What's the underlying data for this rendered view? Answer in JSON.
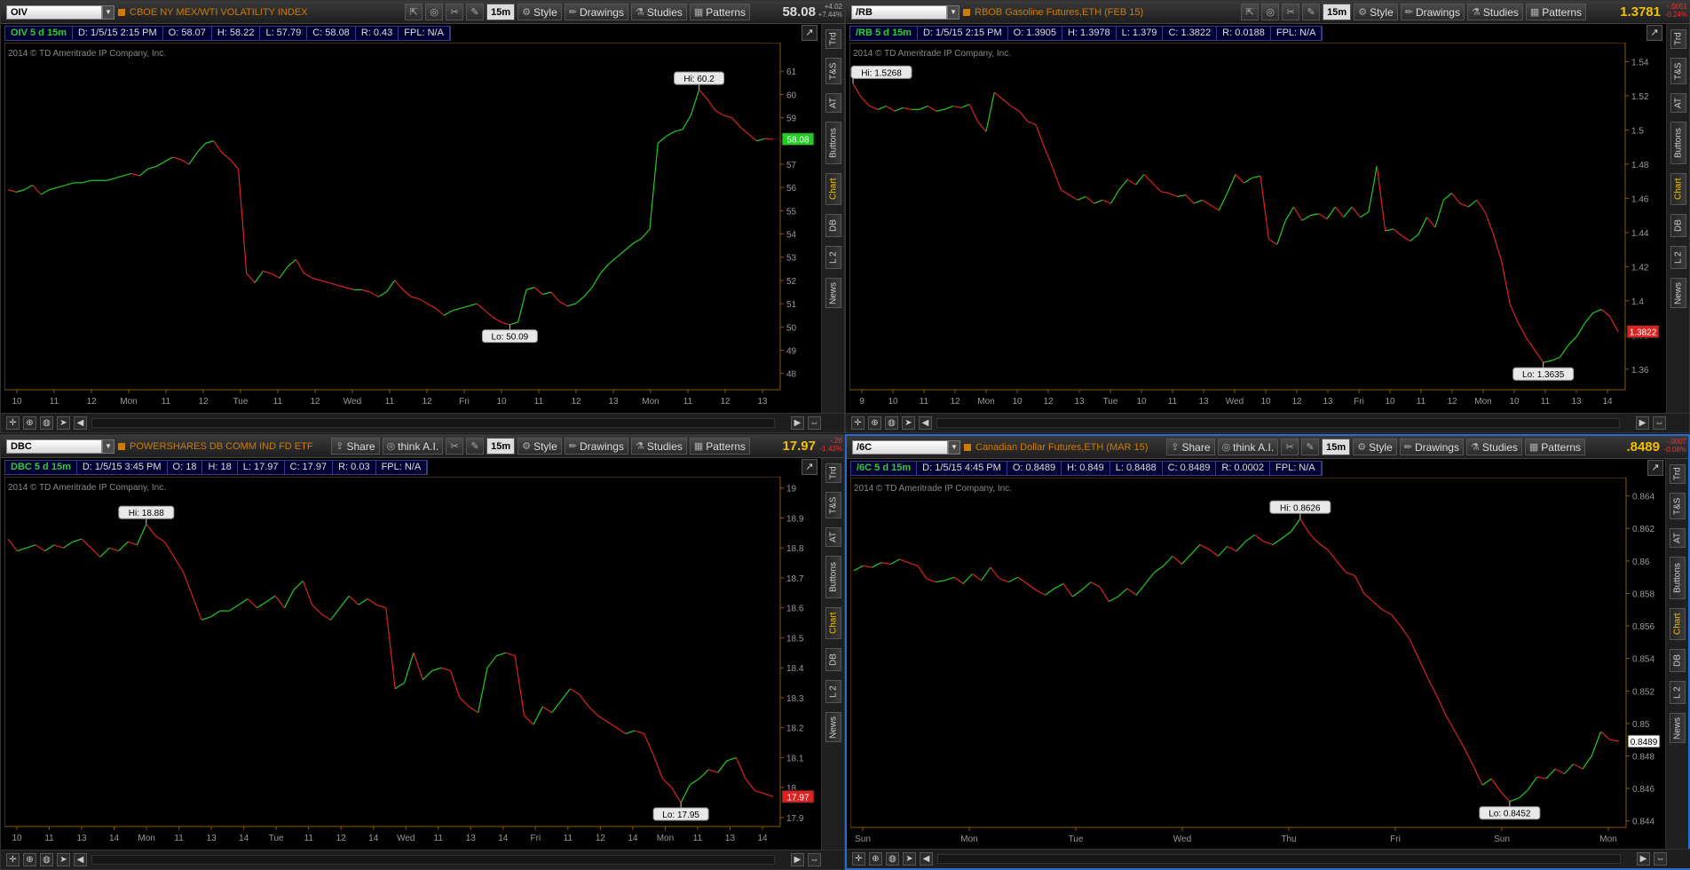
{
  "toolbar_labels": {
    "share": "Share",
    "think": "think A.I.",
    "timeframe": "15m",
    "style": "Style",
    "drawings": "Drawings",
    "studies": "Studies",
    "patterns": "Patterns"
  },
  "side_tabs": [
    "Trd",
    "T&S",
    "AT",
    "Buttons",
    "Chart",
    "DB",
    "L 2",
    "News"
  ],
  "copyright": "2014 © TD Ameritrade IP Company, Inc.",
  "colors": {
    "up": "#22cc22",
    "down": "#dd2222",
    "axis": "#8a5a00",
    "active_border": "#2a6bd0"
  },
  "panes": [
    {
      "symbol": "OIV",
      "description": "CBOE NY MEX/WTI VOLATILITY INDEX",
      "last": "58.08",
      "change_top": "+4.02",
      "change_bottom": "+7.44%",
      "change_dir": "up",
      "show_share": false,
      "active": false,
      "info": {
        "label": "OIV 5 d 15m",
        "date": "D: 1/5/15 2:15 PM",
        "open": "O: 58.07",
        "high": "H: 58.22",
        "low": "L: 57.79",
        "close": "C: 58.08",
        "range": "R: 0.43",
        "fpl": "FPL: N/A"
      },
      "chart_data": {
        "type": "line",
        "ylim": [
          47.3,
          62.0
        ],
        "y_ticks": [
          "48",
          "49",
          "50",
          "51",
          "52",
          "53",
          "54",
          "55",
          "56",
          "57",
          "58",
          "59",
          "60",
          "61"
        ],
        "x_ticks": [
          "10",
          "11",
          "12",
          "Mon",
          "11",
          "12",
          "Tue",
          "11",
          "12",
          "Wed",
          "11",
          "12",
          "Fri",
          "10",
          "11",
          "12",
          "13",
          "Mon",
          "11",
          "12",
          "13"
        ],
        "hi": {
          "label": "Hi: 60.2",
          "value": 60.2
        },
        "lo": {
          "label": "Lo: 50.09",
          "value": 50.09
        },
        "last_price_label": "58.08",
        "last_price_color": "#22cc22",
        "values": [
          55.9,
          55.8,
          55.9,
          56.1,
          55.7,
          55.9,
          56.0,
          56.1,
          56.2,
          56.2,
          56.3,
          56.3,
          56.3,
          56.4,
          56.5,
          56.6,
          56.5,
          56.8,
          56.9,
          57.1,
          57.3,
          57.2,
          57.0,
          57.5,
          57.9,
          58.0,
          57.5,
          57.2,
          56.8,
          52.3,
          51.9,
          52.4,
          52.3,
          52.1,
          52.6,
          52.9,
          52.3,
          52.1,
          52.0,
          51.9,
          51.8,
          51.7,
          51.6,
          51.6,
          51.5,
          51.3,
          51.5,
          52.0,
          51.6,
          51.3,
          51.2,
          51.0,
          50.8,
          50.5,
          50.7,
          50.8,
          50.9,
          51.0,
          50.7,
          50.4,
          50.2,
          50.1,
          50.2,
          51.6,
          51.7,
          51.4,
          51.5,
          51.1,
          50.9,
          51.0,
          51.3,
          51.7,
          52.3,
          52.7,
          53.0,
          53.3,
          53.6,
          53.8,
          54.2,
          57.9,
          58.2,
          58.4,
          58.5,
          59.1,
          60.2,
          59.8,
          59.3,
          59.1,
          59.0,
          58.6,
          58.3,
          58.0,
          58.1,
          58.08
        ]
      }
    },
    {
      "symbol": "/RB",
      "description": "RBOB Gasoline Futures,ETH (FEB 15)",
      "last": "1.3781",
      "change_top": "-.0051",
      "change_bottom": "-0.24%",
      "change_dir": "dn",
      "show_share": false,
      "active": false,
      "info": {
        "label": "/RB 5 d 15m",
        "date": "D: 1/5/15 2:15 PM",
        "open": "O: 1.3905",
        "high": "H: 1.3978",
        "low": "L: 1.379",
        "close": "C: 1.3822",
        "range": "R: 0.0188",
        "fpl": "FPL: N/A"
      },
      "chart_data": {
        "type": "line",
        "ylim": [
          1.348,
          1.548
        ],
        "y_ticks": [
          "1.36",
          "1.38",
          "1.4",
          "1.42",
          "1.44",
          "1.46",
          "1.48",
          "1.5",
          "1.52",
          "1.54"
        ],
        "x_ticks": [
          "9",
          "10",
          "11",
          "12",
          "Mon",
          "10",
          "12",
          "13",
          "Tue",
          "10",
          "11",
          "13",
          "Wed",
          "10",
          "12",
          "13",
          "Fri",
          "10",
          "11",
          "12",
          "Mon",
          "10",
          "11",
          "13",
          "14"
        ],
        "hi": {
          "label": "Hi: 1.5268",
          "value": 1.5268
        },
        "lo": {
          "label": "Lo: 1.3635",
          "value": 1.3635
        },
        "last_price_label": "1.3822",
        "last_price_color": "#dd2222",
        "values": [
          1.527,
          1.519,
          1.514,
          1.512,
          1.514,
          1.511,
          1.513,
          1.512,
          1.512,
          1.514,
          1.511,
          1.512,
          1.514,
          1.513,
          1.515,
          1.505,
          1.499,
          1.522,
          1.518,
          1.514,
          1.511,
          1.505,
          1.503,
          1.49,
          1.478,
          1.465,
          1.462,
          1.459,
          1.461,
          1.457,
          1.459,
          1.457,
          1.465,
          1.471,
          1.468,
          1.474,
          1.469,
          1.464,
          1.463,
          1.461,
          1.462,
          1.457,
          1.459,
          1.456,
          1.453,
          1.463,
          1.474,
          1.469,
          1.472,
          1.473,
          1.436,
          1.433,
          1.447,
          1.455,
          1.447,
          1.45,
          1.451,
          1.448,
          1.455,
          1.449,
          1.455,
          1.449,
          1.452,
          1.479,
          1.441,
          1.442,
          1.438,
          1.435,
          1.439,
          1.449,
          1.443,
          1.459,
          1.463,
          1.457,
          1.455,
          1.459,
          1.452,
          1.439,
          1.423,
          1.398,
          1.387,
          1.378,
          1.371,
          1.364,
          1.365,
          1.367,
          1.374,
          1.379,
          1.387,
          1.393,
          1.395,
          1.391,
          1.382
        ]
      }
    },
    {
      "symbol": "DBC",
      "description": "POWERSHARES DB COMM IND FD ETF",
      "last": "17.97",
      "change_top": "-.26",
      "change_bottom": "-1.43%",
      "change_dir": "dn",
      "show_share": true,
      "active": false,
      "info": {
        "label": "DBC 5 d 15m",
        "date": "D: 1/5/15 3:45 PM",
        "open": "O: 18",
        "high": "H: 18",
        "low": "L: 17.97",
        "close": "C: 17.97",
        "range": "R: 0.03",
        "fpl": "FPL: N/A"
      },
      "chart_data": {
        "type": "line",
        "ylim": [
          17.87,
          19.02
        ],
        "y_ticks": [
          "17.9",
          "18",
          "18.1",
          "18.2",
          "18.3",
          "18.4",
          "18.5",
          "18.6",
          "18.7",
          "18.8",
          "18.9",
          "19"
        ],
        "x_ticks": [
          "10",
          "11",
          "13",
          "14",
          "Mon",
          "11",
          "13",
          "14",
          "Tue",
          "11",
          "12",
          "14",
          "Wed",
          "11",
          "13",
          "14",
          "Fri",
          "11",
          "12",
          "14",
          "Mon",
          "11",
          "13",
          "14"
        ],
        "hi": {
          "label": "Hi: 18.88",
          "value": 18.88
        },
        "lo": {
          "label": "Lo: 17.95",
          "value": 17.95
        },
        "last_price_label": "17.97",
        "last_price_color": "#dd2222",
        "values": [
          18.83,
          18.79,
          18.8,
          18.81,
          18.79,
          18.81,
          18.8,
          18.82,
          18.83,
          18.8,
          18.77,
          18.8,
          18.79,
          18.82,
          18.81,
          18.88,
          18.84,
          18.82,
          18.77,
          18.72,
          18.64,
          18.56,
          18.57,
          18.59,
          18.59,
          18.61,
          18.63,
          18.6,
          18.62,
          18.64,
          18.6,
          18.66,
          18.69,
          18.61,
          18.58,
          18.56,
          18.6,
          18.64,
          18.61,
          18.63,
          18.61,
          18.6,
          18.33,
          18.35,
          18.45,
          18.36,
          18.39,
          18.4,
          18.39,
          18.3,
          18.27,
          18.25,
          18.4,
          18.44,
          18.45,
          18.44,
          18.24,
          18.21,
          18.27,
          18.25,
          18.29,
          18.33,
          18.31,
          18.27,
          18.24,
          18.22,
          18.2,
          18.18,
          18.19,
          18.18,
          18.11,
          18.03,
          18.0,
          17.95,
          18.01,
          18.03,
          18.06,
          18.05,
          18.09,
          18.1,
          18.03,
          17.99,
          17.98,
          17.97
        ]
      }
    },
    {
      "symbol": "/6C",
      "description": "Canadian Dollar Futures,ETH (MAR 15)",
      "last": ".8489",
      "change_top": "-.0007",
      "change_bottom": "-0.08%",
      "change_dir": "dn",
      "show_share": true,
      "active": true,
      "info": {
        "label": "/6C 5 d 15m",
        "date": "D: 1/5/15 4:45 PM",
        "open": "O: 0.8489",
        "high": "H: 0.849",
        "low": "L: 0.8488",
        "close": "C: 0.8489",
        "range": "R: 0.0002",
        "fpl": "FPL: N/A"
      },
      "chart_data": {
        "type": "line",
        "ylim": [
          0.8436,
          0.8648
        ],
        "y_ticks": [
          "0.844",
          "0.846",
          "0.848",
          "0.85",
          "0.852",
          "0.854",
          "0.856",
          "0.858",
          "0.86",
          "0.862",
          "0.864"
        ],
        "x_ticks": [
          "Sun",
          "Mon",
          "Tue",
          "Wed",
          "Thu",
          "Fri",
          "Sun",
          "Mon"
        ],
        "hi": {
          "label": "Hi: 0.8626",
          "value": 0.8626
        },
        "lo": {
          "label": "Lo: 0.8452",
          "value": 0.8452
        },
        "last_price_label": "0.8489",
        "last_price_color": "#ffffff",
        "values": [
          0.8594,
          0.8597,
          0.8596,
          0.8599,
          0.8598,
          0.8601,
          0.8599,
          0.8597,
          0.8589,
          0.8587,
          0.8588,
          0.859,
          0.8586,
          0.8592,
          0.8588,
          0.8596,
          0.8589,
          0.8587,
          0.859,
          0.8586,
          0.8582,
          0.8579,
          0.8583,
          0.8586,
          0.8578,
          0.8582,
          0.8587,
          0.8584,
          0.8575,
          0.8578,
          0.8583,
          0.8579,
          0.8586,
          0.8593,
          0.8597,
          0.8603,
          0.8598,
          0.8604,
          0.861,
          0.8607,
          0.8603,
          0.8609,
          0.8606,
          0.8612,
          0.8616,
          0.8612,
          0.861,
          0.8614,
          0.8618,
          0.8626,
          0.8617,
          0.8611,
          0.8607,
          0.86,
          0.8593,
          0.8591,
          0.858,
          0.8575,
          0.857,
          0.8567,
          0.856,
          0.8552,
          0.854,
          0.8528,
          0.8517,
          0.8505,
          0.8495,
          0.8485,
          0.8474,
          0.8462,
          0.8466,
          0.8458,
          0.8452,
          0.8454,
          0.8459,
          0.8467,
          0.8466,
          0.8472,
          0.8469,
          0.8475,
          0.8472,
          0.848,
          0.8495,
          0.849,
          0.8489
        ]
      }
    }
  ]
}
